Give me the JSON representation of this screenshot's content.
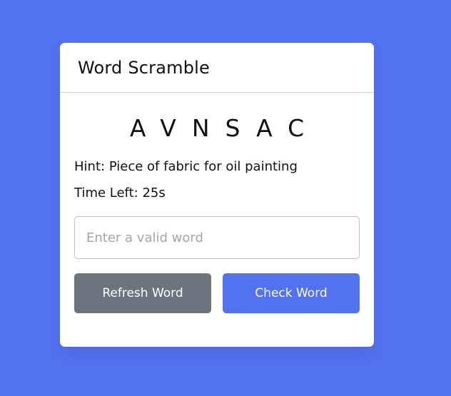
{
  "app": {
    "title": "Word Scramble"
  },
  "game": {
    "scrambled_word": "AVNSAC",
    "hint_label": "Hint:",
    "hint_text": "Piece of fabric for oil painting",
    "time_label": "Time Left:",
    "time_value": "25s"
  },
  "input": {
    "value": "",
    "placeholder": "Enter a valid word"
  },
  "buttons": {
    "refresh_label": "Refresh Word",
    "check_label": "Check Word"
  },
  "colors": {
    "background": "#5372F0",
    "card": "#FFFFFF",
    "refresh_button": "#6C757D",
    "check_button": "#5372F0"
  }
}
